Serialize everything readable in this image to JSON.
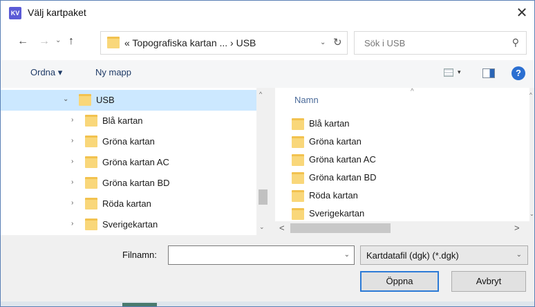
{
  "window": {
    "title": "Välj kartpaket",
    "app_icon_text": "KV",
    "close_label": "✕"
  },
  "nav": {
    "back_label": "←",
    "forward_label": "→",
    "history_label": "⌄",
    "up_label": "↑",
    "address_path": "« Topografiska kartan ...  ›  USB",
    "address_dropdown": "⌄",
    "refresh_label": "↻",
    "search_placeholder": "Sök i USB",
    "search_icon": "⚲"
  },
  "toolbar": {
    "organize_label": "Ordna ▾",
    "new_folder_label": "Ny mapp",
    "view_dropdown": "▾",
    "help_label": "?"
  },
  "tree": {
    "items": [
      {
        "label": "USB",
        "chevron": "⌄",
        "selected": true
      },
      {
        "label": "Blå kartan",
        "chevron": "›"
      },
      {
        "label": "Gröna kartan",
        "chevron": "›"
      },
      {
        "label": "Gröna kartan AC",
        "chevron": "›"
      },
      {
        "label": "Gröna kartan BD",
        "chevron": "›"
      },
      {
        "label": "Röda kartan",
        "chevron": "›"
      },
      {
        "label": "Sverigekartan",
        "chevron": "›"
      }
    ],
    "scroll_up": "^",
    "scroll_down": "⌄"
  },
  "content": {
    "sort_indicator": "^",
    "column_name": "Namn",
    "files": [
      {
        "label": "Blå kartan"
      },
      {
        "label": "Gröna kartan"
      },
      {
        "label": "Gröna kartan AC"
      },
      {
        "label": "Gröna kartan BD"
      },
      {
        "label": "Röda kartan"
      },
      {
        "label": "Sverigekartan"
      }
    ],
    "scroll_left": "<",
    "scroll_right": ">"
  },
  "bottom": {
    "filename_label": "Filnamn:",
    "filename_value": "",
    "filename_dropdown": "⌄",
    "filetype_value": "Kartdatafil (dgk) (*.dgk)",
    "filetype_dropdown": "⌄",
    "open_label": "Öppna",
    "cancel_label": "Avbryt"
  }
}
